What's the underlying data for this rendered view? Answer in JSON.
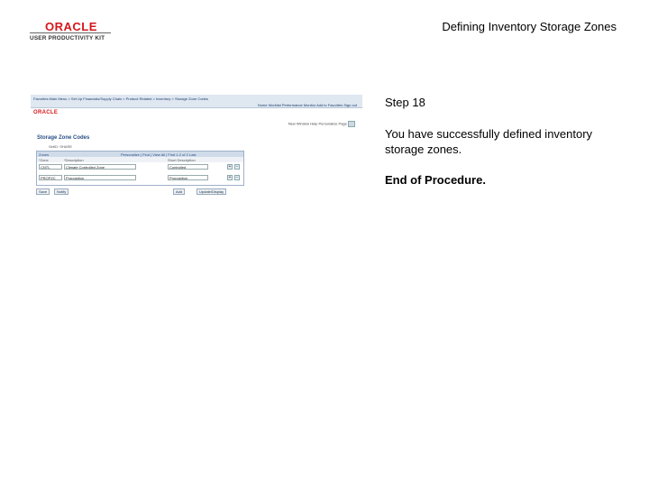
{
  "header": {
    "logo_oracle": "ORACLE",
    "logo_subtitle": "USER PRODUCTIVITY KIT",
    "title": "Defining Inventory Storage Zones"
  },
  "step": {
    "label": "Step 18",
    "message": "You have successfully defined inventory storage zones.",
    "end": "End of Procedure."
  },
  "screenshot": {
    "nav_top": "Favorites   Main Menu  >  Set Up Financials/Supply Chain  >  Product Related  >  Inventory  >  Storage Zone Codes",
    "nav_links": "Home   Worklist   Performance Monitor   Add to Favorites   Sign out",
    "oracle": "ORACLE",
    "toolbar": "New Window   Help   Personalize Page",
    "page_title": "Storage Zone Codes",
    "setid": "SetID:  SHARE",
    "grid_label": "Zones",
    "grid_tools": "Personalize | Find | View All |  First  1-2 of 2  Last",
    "columns": [
      "*Zone",
      "*Description",
      "Short Description"
    ],
    "rows": [
      {
        "zone": "CNTL",
        "description": "Climate Controlled Zone",
        "short": "Controlled"
      },
      {
        "zone": "PROPZC",
        "description": "Proposition",
        "short": "Proposition"
      }
    ],
    "buttons": {
      "save": "Save",
      "notify": "Notify",
      "add": "Add",
      "update": "Update/Display"
    }
  }
}
